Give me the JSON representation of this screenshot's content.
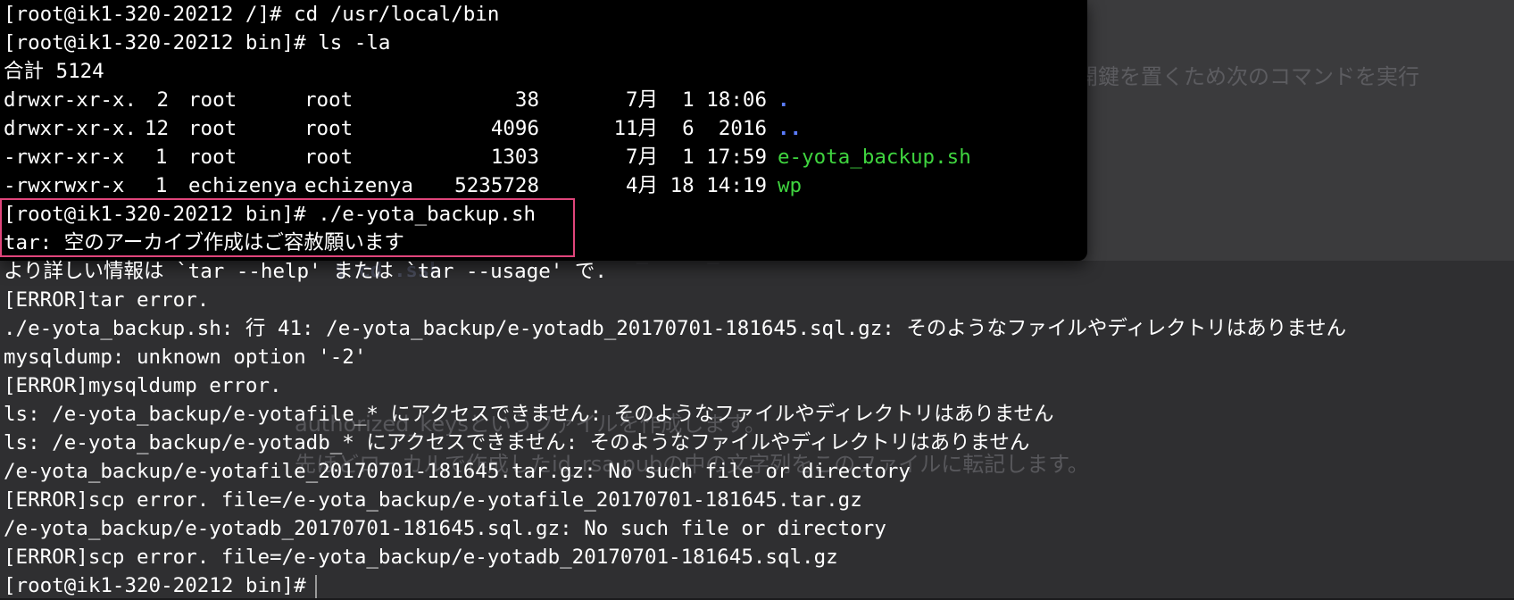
{
  "terminal": {
    "prompt_cd": "[root@ik1-320-20212 /]# cd /usr/local/bin",
    "prompt_ls": "[root@ik1-320-20212 bin]# ls -la",
    "total": "合計 5124",
    "listing": [
      {
        "perm": "drwxr-xr-x.",
        "links": "2",
        "owner": "root",
        "group": "root",
        "size": "38",
        "date": "7月  1 18:06",
        "name": "."
      },
      {
        "perm": "drwxr-xr-x.",
        "links": "12",
        "owner": "root",
        "group": "root",
        "size": "4096",
        "date": "11月  6  2016",
        "name": ".."
      },
      {
        "perm": "-rwxr-xr-x",
        "links": "1",
        "owner": "root",
        "group": "root",
        "size": "1303",
        "date": "7月  1 17:59",
        "name": "e-yota_backup.sh"
      },
      {
        "perm": "-rwxrwxr-x",
        "links": "1",
        "owner": "echizenya",
        "group": "echizenya",
        "size": "5235728",
        "date": "4月 18 14:19",
        "name": "wp"
      }
    ],
    "prompt_run": "[root@ik1-320-20212 bin]# ./e-yota_backup.sh",
    "tar_error": "tar: 空のアーカイブ作成はご容赦願います",
    "output_lines": [
      "より詳しい情報は `tar --help' または `tar --usage' で.",
      "[ERROR]tar error.",
      "./e-yota_backup.sh: 行 41: /e-yota_backup/e-yotadb_20170701-181645.sql.gz: そのようなファイルやディレクトリはありません",
      "mysqldump: unknown option '-2'",
      "[ERROR]mysqldump error.",
      "ls: /e-yota_backup/e-yotafile_* にアクセスできません: そのようなファイルやディレクトリはありません",
      "ls: /e-yota_backup/e-yotadb_* にアクセスできません: そのようなファイルやディレクトリはありません",
      "/e-yota_backup/e-yotafile_20170701-181645.tar.gz: No such file or directory",
      "[ERROR]scp error. file=/e-yota_backup/e-yotafile_20170701-181645.tar.gz",
      "/e-yota_backup/e-yotadb_20170701-181645.sql.gz: No such file or directory",
      "[ERROR]scp error. file=/e-yota_backup/e-yotadb_20170701-181645.sql.gz"
    ],
    "final_prompt": "[root@ik1-320-20212 bin]#"
  },
  "colors": {
    "background": "#000000",
    "text": "#ffffff",
    "directory": "#5b7cff",
    "executable": "#3fd43f",
    "highlight": "#e0457b"
  }
}
